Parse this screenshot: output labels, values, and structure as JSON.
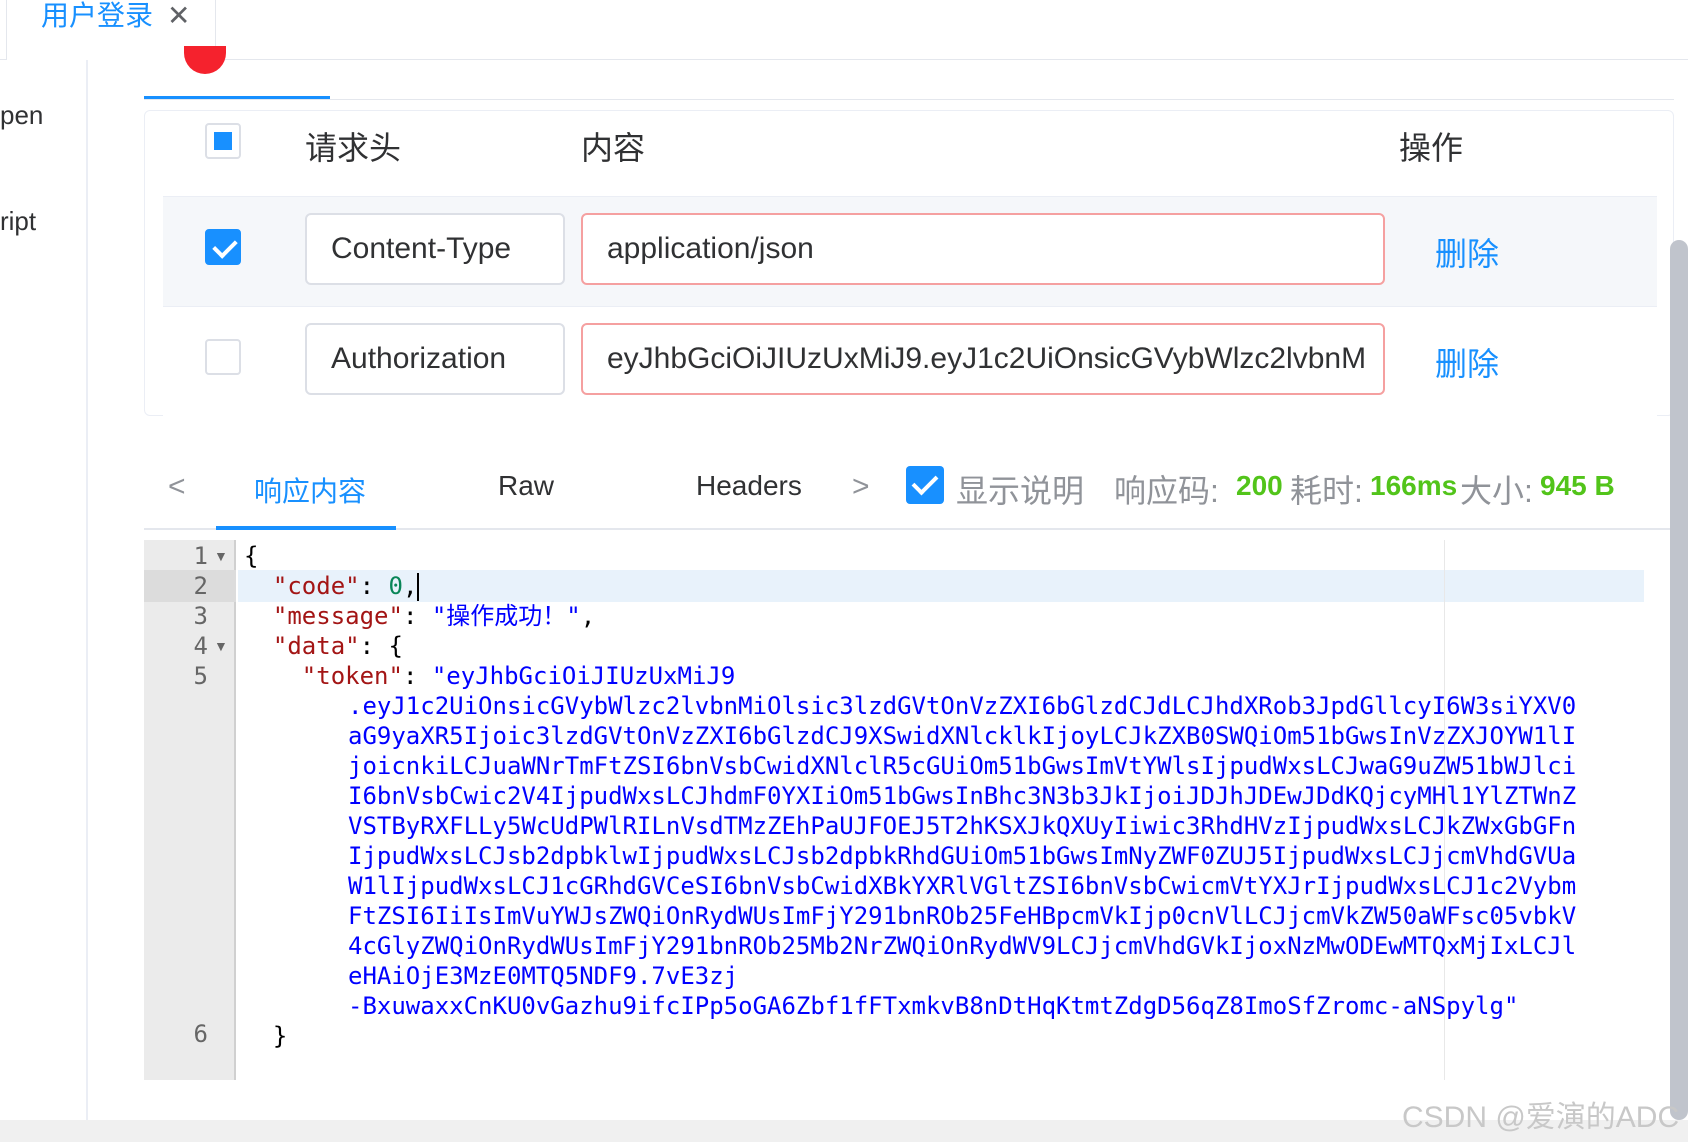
{
  "tab": {
    "title": "用户登录",
    "close_glyph": "✕"
  },
  "sidebar": {
    "items": [
      "pen",
      "ript"
    ]
  },
  "headers_table": {
    "columns": [
      "请求头",
      "内容",
      "操作"
    ],
    "rows": [
      {
        "checked": true,
        "key": "Content-Type",
        "value": "application/json",
        "action": "删除"
      },
      {
        "checked": false,
        "key": "Authorization",
        "value": "eyJhbGciOiJIUzUxMiJ9.eyJ1c2UiOnsicGVybWlzc2lvbnM",
        "action": "删除"
      }
    ]
  },
  "response_tabs": {
    "prev": "<",
    "next": ">",
    "items": [
      "响应内容",
      "Raw",
      "Headers"
    ],
    "active": "响应内容"
  },
  "response_meta": {
    "show_desc_label": "显示说明",
    "show_desc_checked": true,
    "code_label": "响应码:",
    "code_value": "200",
    "time_label": "耗时:",
    "time_value": "166ms",
    "size_label": "大小:",
    "size_value": "945 B"
  },
  "editor": {
    "line_numbers": [
      "1",
      "2",
      "3",
      "4",
      "5",
      "6"
    ],
    "lines": {
      "l1": "{",
      "l2_key": "\"code\"",
      "l2_val": "0",
      "l3_key": "\"message\"",
      "l3_val": "\"操作成功！\"",
      "l4_key": "\"data\"",
      "l5_key": "\"token\"",
      "l5_val": "\"eyJhbGciOiJIUzUxMiJ9",
      "token_wrap": [
        ".eyJ1c2UiOnsicGVybWlzc2lvbnMiOlsic3lzdGVtOnVzZXI6bGlzdCJdLCJhdXRob3JpdGllcyI6W3siYXV0",
        "aG9yaXR5Ijoic3lzdGVtOnVzZXI6bGlzdCJ9XSwidXNlcklkIjoyLCJkZXB0SWQiOm51bGwsInVzZXJOYW1lI",
        "joicnkiLCJuaWNrTmFtZSI6bnVsbCwidXNlclR5cGUiOm51bGwsImVtYWlsIjpudWxsLCJwaG9uZW51bWJlci",
        "I6bnVsbCwic2V4IjpudWxsLCJhdmF0YXIiOm51bGwsInBhc3N3b3JkIjoiJDJhJDEwJDdKQjcyMHl1YlZTWnZ",
        "VSTByRXFLLy5WcUdPWlRILnVsdTMzZEhPaUJFOEJ5T2hKSXJkQXUyIiwic3RhdHVzIjpudWxsLCJkZWxGbGFn",
        "IjpudWxsLCJsb2dpbklwIjpudWxsLCJsb2dpbkRhdGUiOm51bGwsImNyZWF0ZUJ5IjpudWxsLCJjcmVhdGVUa",
        "W1lIjpudWxsLCJ1cGRhdGVCeSI6bnVsbCwidXBkYXRlVGltZSI6bnVsbCwicmVtYXJrIjpudWxsLCJ1c2Vybm",
        "FtZSI6IiIsImVuYWJsZWQiOnRydWUsImFjY291bnROb25FeHBpcmVkIjp0cnVlLCJjcmVkZW50aWFsc05vbkV",
        "4cGlyZWQiOnRydWUsImFjY291bnROb25Mb2NrZWQiOnRydWV9LCJjcmVhdGVkIjoxNzMwODEwMTQxMjIxLCJl",
        "eHAiOjE3MzE0MTQ5NDF9.7vE3zj",
        "-BxuwaxxCnKU0vGazhu9ifcIPp5oGA6Zbf1fFTxmkvB8nDtHqKtmtZdgD56qZ8ImoSfZromc-aNSpylg\""
      ],
      "l6": "}"
    }
  },
  "watermark": "CSDN @爱演的ADC",
  "colors": {
    "accent": "#1890ff",
    "success": "#52c41a",
    "error_border": "#f5a0a0"
  }
}
